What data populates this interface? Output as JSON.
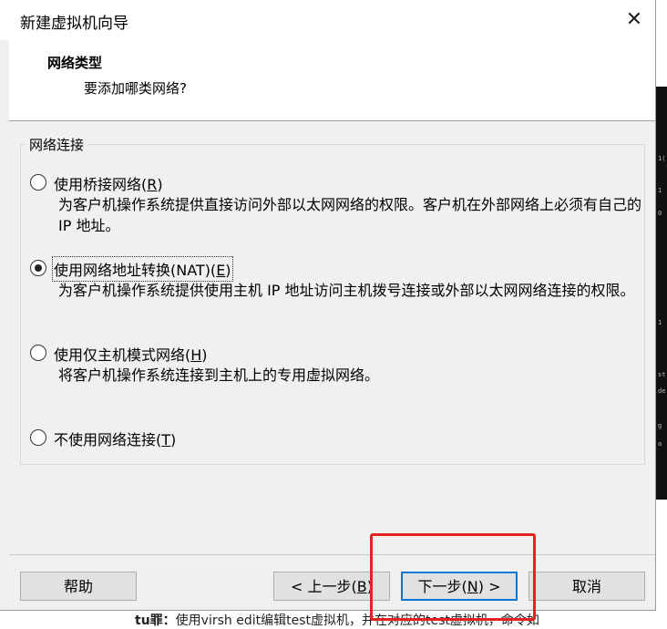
{
  "window": {
    "title": "新建虚拟机向导",
    "close_glyph": "✕"
  },
  "header": {
    "title": "网络类型",
    "subtitle": "要添加哪类网络?"
  },
  "network_group": {
    "label": "网络连接",
    "options": [
      {
        "label_prefix": "使用桥接网络(",
        "mnemonic": "R",
        "label_suffix": ")",
        "description": "为客户机操作系统提供直接访问外部以太网网络的权限。客户机在外部网络上必须有自己的 IP 地址。",
        "checked": false
      },
      {
        "label_prefix": "使用网络地址转换(NAT)(",
        "mnemonic": "E",
        "label_suffix": ")",
        "description": "为客户机操作系统提供使用主机 IP 地址访问主机拨号连接或外部以太网网络连接的权限。",
        "checked": true
      },
      {
        "label_prefix": "使用仅主机模式网络(",
        "mnemonic": "H",
        "label_suffix": ")",
        "description": "将客户机操作系统连接到主机上的专用虚拟网络。",
        "checked": false
      },
      {
        "label_prefix": "不使用网络连接(",
        "mnemonic": "T",
        "label_suffix": ")",
        "description": "",
        "checked": false
      }
    ]
  },
  "buttons": {
    "help": "帮助",
    "back_prefix": "< 上一步(",
    "back_mnemonic": "B",
    "back_suffix": ")",
    "next_prefix": "下一步(",
    "next_mnemonic": "N",
    "next_suffix": ") >",
    "cancel": "取消"
  },
  "background": {
    "doc_bold": "tu罪：",
    "doc_text": "使用virsh edit编辑test虚拟机，并在对应的test虚拟机，命令如",
    "terminal_lines": [
      "1(",
      "1",
      "0",
      "1",
      "st",
      "de",
      "g",
      "a"
    ]
  },
  "colors": {
    "dialog_bg": "#f0f0f0",
    "accent": "#0078d7",
    "highlight_box": "#e52222"
  }
}
